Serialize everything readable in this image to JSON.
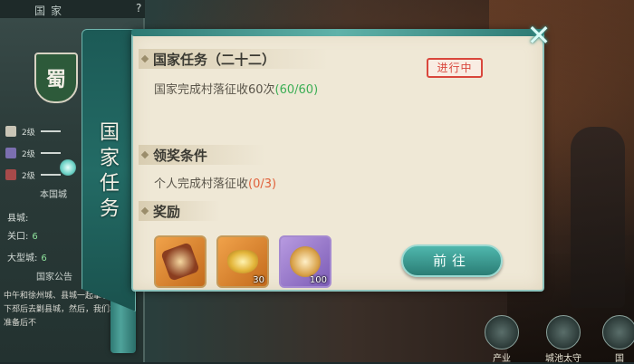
{
  "left_panel": {
    "header_title": "国家",
    "help_label": "?",
    "kingdom_char": "蜀",
    "ranks": [
      {
        "label": "2级"
      },
      {
        "label": "2级"
      },
      {
        "label": "2级"
      }
    ],
    "city_title": "本国城",
    "stats": [
      {
        "label": "县城:"
      },
      {
        "label": "关口:",
        "value": "6"
      },
      {
        "label": "大型城:",
        "value": "6"
      }
    ],
    "notice_title": "国家公告",
    "notice_text": "中午和徐州城、县城一起拿了，打下下邳后去剿县城，然后，我们地工地准备后不"
  },
  "modal": {
    "tab_title": "国家任务",
    "close_label": "✕",
    "task_section": {
      "title": "国家任务（二十二）",
      "desc": "国家完成村落征收60次",
      "progress": "(60/60)",
      "status": "进行中"
    },
    "condition_section": {
      "title": "领奖条件",
      "desc": "个人完成村落征收",
      "progress": "(0/3)"
    },
    "reward_section": {
      "title": "奖励",
      "items": [
        {
          "icon": "scroll-token-icon",
          "count": ""
        },
        {
          "icon": "gold-ingot-icon",
          "count": "30"
        },
        {
          "icon": "medal-icon",
          "count": "100"
        }
      ]
    },
    "go_button": "前往"
  },
  "bottom_nav": [
    {
      "label": "产业",
      "icon": "industry-icon"
    },
    {
      "label": "城池太守",
      "icon": "city-governor-icon"
    },
    {
      "label": "国",
      "icon": "kingdom-icon"
    }
  ],
  "colors": {
    "progress_done": "#3cae55",
    "progress_pending": "#e0603a",
    "status_red": "#d9473c",
    "accent_teal": "#2b7d75"
  }
}
